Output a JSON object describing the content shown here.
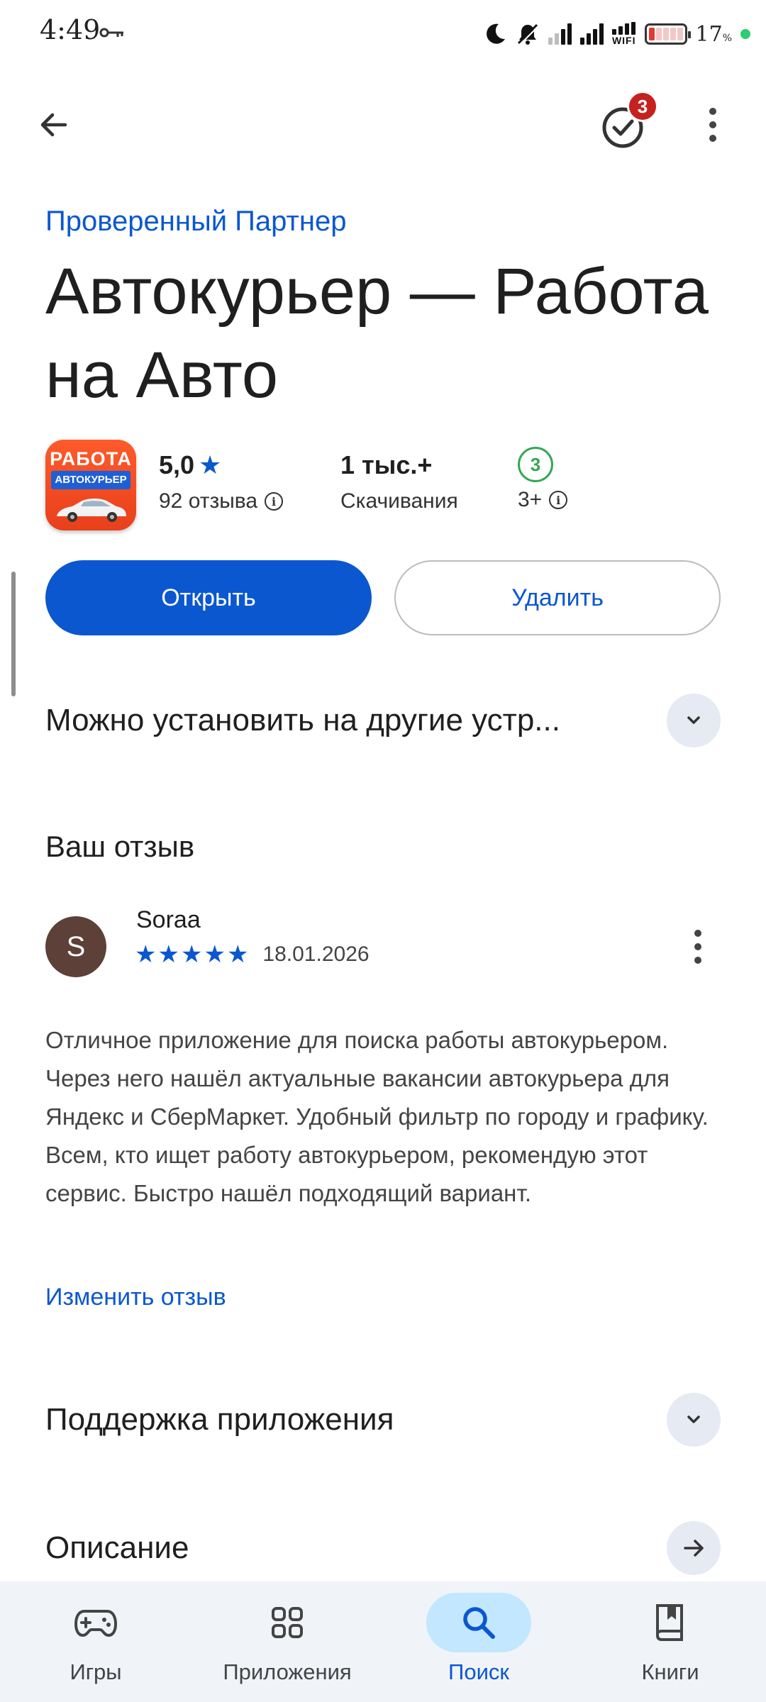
{
  "status_bar": {
    "time": "4:49",
    "wifi_label": "WIFI",
    "battery_percent": "17",
    "percent_sign": "%"
  },
  "top_bar": {
    "updates_badge": "3"
  },
  "app": {
    "partner_label": "Проверенный Партнер",
    "title": "Автокурьер — Работа на Авто",
    "icon_text_top": "РАБОТА",
    "icon_text_banner": "АВТОКУРЬЕР",
    "rating_value": "5,0",
    "reviews_label": "92 отзыва",
    "downloads_value": "1 тыс.+",
    "downloads_label": "Скачивания",
    "age_badge": "3",
    "age_label": "3+"
  },
  "actions": {
    "open_label": "Открыть",
    "uninstall_label": "Удалить"
  },
  "sections": {
    "other_devices": "Можно установить на другие устр...",
    "support": "Поддержка приложения",
    "description": "Описание"
  },
  "review": {
    "heading": "Ваш отзыв",
    "avatar_letter": "S",
    "reviewer_name": "Soraa",
    "stars": 5,
    "date": "18.01.2026",
    "text": "Отличное приложение для поиска работы автокурьером. Через него нашёл актуальные вакансии автокурьера для Яндекс и СберМаркет. Удобный фильтр по городу и графику. Всем, кто ищет работу автокурьером, рекомендую этот сервис. Быстро нашёл подходящий вариант.",
    "edit_label": "Изменить отзыв"
  },
  "bottom_nav": {
    "games": "Игры",
    "apps": "Приложения",
    "search": "Поиск",
    "books": "Книги"
  },
  "colors": {
    "accent": "#0b57d0",
    "badge_red": "#c5221f",
    "age_green": "#34a853",
    "nav_bg": "#f0f4f9",
    "nav_active_pill": "#c2e7ff"
  }
}
